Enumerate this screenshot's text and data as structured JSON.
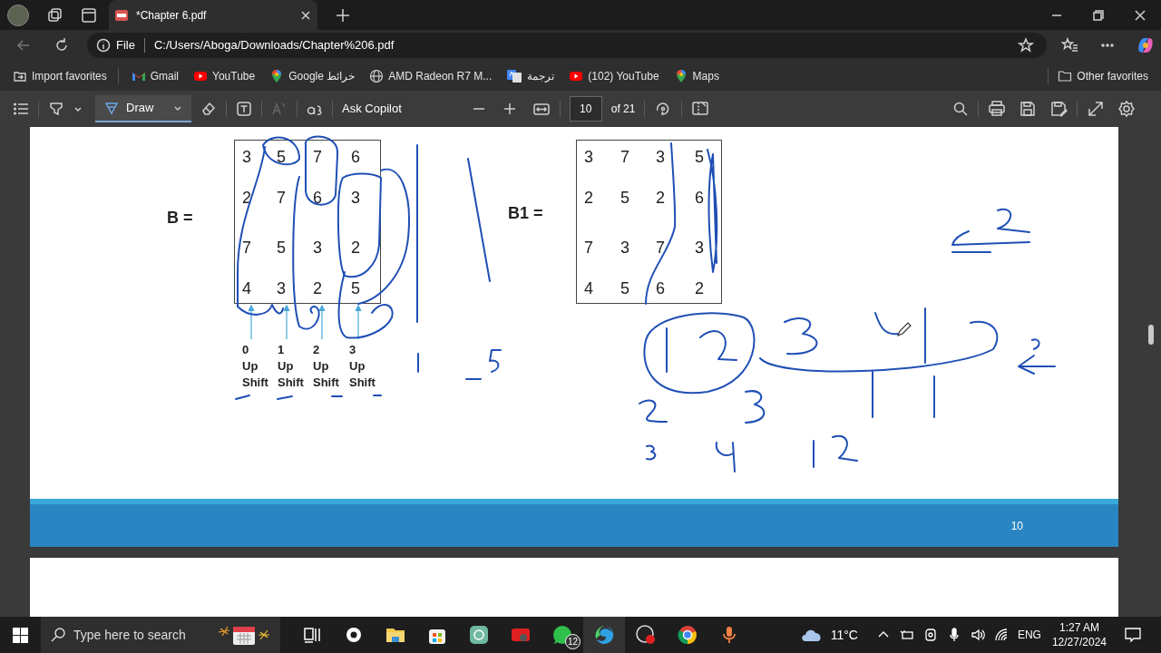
{
  "tabs": [
    {
      "title": "*Chapter 6.pdf",
      "selected": true
    }
  ],
  "address_bar": {
    "scheme": "File",
    "url": "C:/Users/Aboga/Downloads/Chapter%206.pdf"
  },
  "favorites": [
    {
      "label": "Import favorites",
      "kind": "import"
    },
    {
      "label": "Gmail",
      "kind": "gmail"
    },
    {
      "label": "YouTube",
      "kind": "youtube"
    },
    {
      "label": "Google خرائط",
      "kind": "maps"
    },
    {
      "label": "AMD Radeon R7 M...",
      "kind": "globe"
    },
    {
      "label": "ترجمة",
      "kind": "translate"
    },
    {
      "label": "(102) YouTube",
      "kind": "youtube"
    },
    {
      "label": "Maps",
      "kind": "maps"
    }
  ],
  "other_favorites": "Other favorites",
  "pdf_toolbar": {
    "draw_label": "Draw",
    "draw_selected": true,
    "copilot_label": "Ask Copilot",
    "page": "10",
    "page_total": "of 21"
  },
  "page": {
    "matrices": [
      {
        "label": "B =",
        "rows": [
          [
            "3",
            "5",
            "7",
            "6"
          ],
          [
            "2",
            "7",
            "6",
            "3"
          ],
          [
            "7",
            "5",
            "3",
            "2"
          ],
          [
            "4",
            "3",
            "2",
            "5"
          ]
        ]
      },
      {
        "label": "B1 =",
        "rows": [
          [
            "3",
            "7",
            "3",
            "5"
          ],
          [
            "2",
            "5",
            "2",
            "6"
          ],
          [
            "7",
            "3",
            "7",
            "3"
          ],
          [
            "4",
            "5",
            "6",
            "2"
          ]
        ]
      }
    ],
    "shift_labels": [
      [
        "0",
        "Up",
        "Shift"
      ],
      [
        "1",
        "Up",
        "Shift"
      ],
      [
        "2",
        "Up",
        "Shift"
      ],
      [
        "3",
        "Up",
        "Shift"
      ]
    ],
    "footer_page_number": "10"
  },
  "taskbar": {
    "search_placeholder": "Type here to search",
    "whatsapp_badge": "12",
    "weather": "11°C",
    "language": "ENG",
    "time": "1:27 AM",
    "date": "12/27/2024"
  }
}
